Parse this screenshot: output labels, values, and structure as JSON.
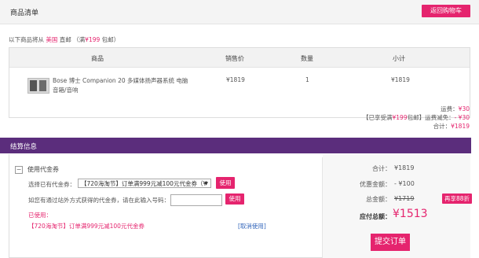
{
  "header": {
    "title": "商品清单",
    "return_button": "返回购物车"
  },
  "ship_note": {
    "prefix": "以下商品将从",
    "origin": "美国",
    "mode": "直邮",
    "free_note_prefix": "（满",
    "free_amount": "¥199",
    "free_note_suffix": "包邮）"
  },
  "table": {
    "headers": [
      "商品",
      "销售价",
      "数量",
      "小计"
    ],
    "rows": [
      {
        "name_line1": "Bose 博士 Companion 20 多媒体扬声器系统 电脑",
        "name_line2": "音箱/音响",
        "price": "¥1819",
        "qty": "1",
        "subtotal": "¥1819"
      }
    ]
  },
  "summary": {
    "shipping_label": "运费：",
    "shipping_value": "¥30",
    "reduce_prefix": "【已享受满",
    "reduce_amount": "¥199",
    "reduce_suffix": "包邮】运费减免：",
    "reduce_value": "- ¥30",
    "total_label": "合计：",
    "total_value": "¥1819"
  },
  "settle": {
    "title": "结算信息",
    "coupon_checkbox": "−",
    "coupon_title": "使用代金券",
    "select_label": "选择已有代金券：",
    "select_value": "【720海淘节】订单满999元减100元代金券（¥",
    "use_button": "使用",
    "code_label": "如您有通过站外方式获得的代金券，请在此输入号码：",
    "code_use_button": "使用",
    "used_label": "已使用：",
    "used_coupon": "【720海淘节】订单满999元减100元代金券",
    "cancel_link": "[取消使用]"
  },
  "totals": {
    "subtotal_label": "合计：",
    "subtotal_value": "¥1819",
    "discount_label": "优惠金额：",
    "discount_value": "- ¥100",
    "amount_label": "总金额：",
    "amount_value": "¥1719",
    "badge": "再享88折",
    "payable_label": "应付总额：",
    "payable_value": "¥1513",
    "submit_button": "提交订单"
  },
  "colors": {
    "accent": "#e5246e",
    "bar": "#5b2d7c"
  }
}
